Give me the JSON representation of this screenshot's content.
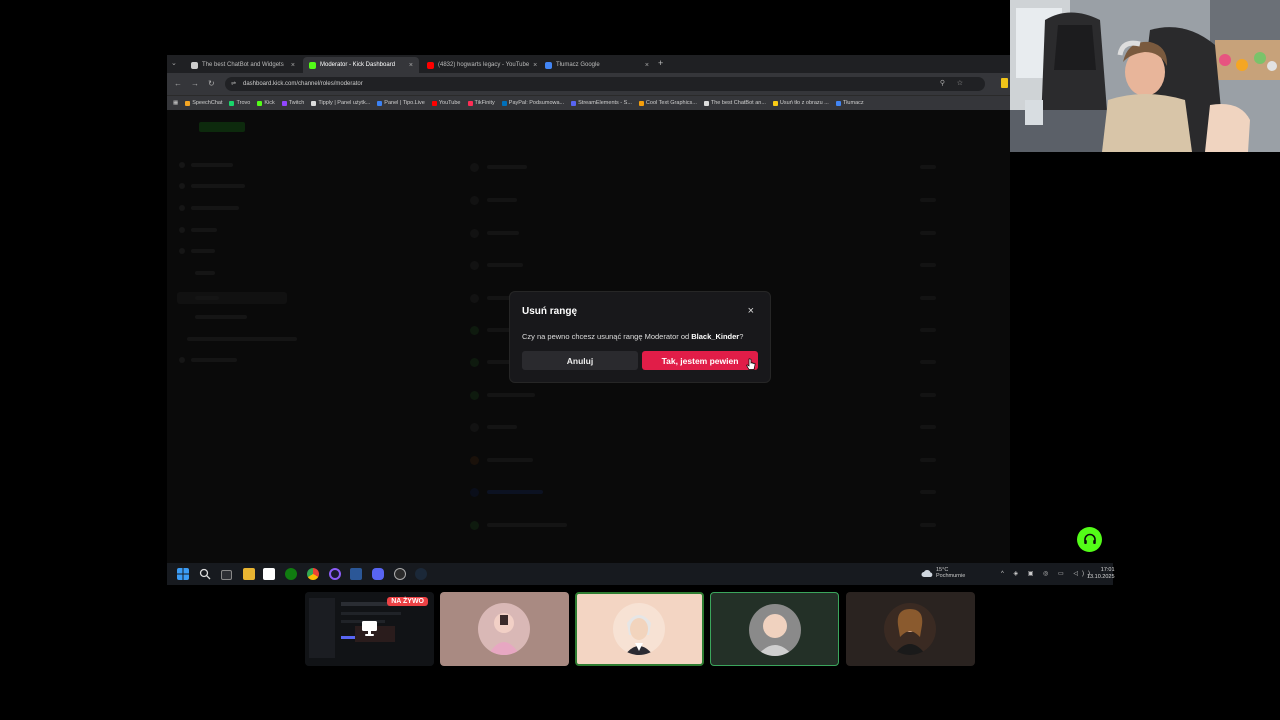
{
  "browser": {
    "tabs": [
      {
        "label": "The best ChatBot and Widgets",
        "active": false,
        "color": "#cccccc"
      },
      {
        "label": "Moderator - Kick Dashboard",
        "active": true,
        "color": "#53fc18"
      },
      {
        "label": "(4832) hogwarts legacy - YouTube",
        "active": false,
        "color": "#ff0000"
      },
      {
        "label": "Tłumacz Google",
        "active": false,
        "color": "#4285f4"
      }
    ],
    "new_tab": "+",
    "url": "dashboard.kick.com/channel/roles/moderator",
    "bookmarks": [
      {
        "label": "SpeechChat",
        "color": "#f5a623"
      },
      {
        "label": "Trovo",
        "color": "#19d66b"
      },
      {
        "label": "Kick",
        "color": "#53fc18"
      },
      {
        "label": "Twitch",
        "color": "#9146ff"
      },
      {
        "label": "Tipply | Panel użytk...",
        "color": "#dddddd"
      },
      {
        "label": "Panel | Tipo.Live",
        "color": "#3b82f6"
      },
      {
        "label": "YouTube",
        "color": "#ff0000"
      },
      {
        "label": "TikFinity",
        "color": "#ff2d55"
      },
      {
        "label": "PayPal: Podsumowa...",
        "color": "#0070ba"
      },
      {
        "label": "StreamElements - S...",
        "color": "#5865f2"
      },
      {
        "label": "Cool Text Graphics...",
        "color": "#f59e0b"
      },
      {
        "label": "The best ChatBot an...",
        "color": "#dddddd"
      },
      {
        "label": "Usuń tło z obrazu ...",
        "color": "#facc15"
      },
      {
        "label": "Tłumacz",
        "color": "#4285f4"
      }
    ]
  },
  "modal": {
    "title": "Usuń rangę",
    "close_icon": "×",
    "message_prefix": "Czy na pewno chcesz usunąć rangę Moderator od ",
    "username": "Black_Kinder",
    "message_suffix": "?",
    "cancel_label": "Anuluj",
    "confirm_label": "Tak, jestem pewien",
    "confirm_color": "#e11d48"
  },
  "taskbar": {
    "weather_temp": "15°C",
    "weather_desc": "Pochmurnie",
    "time": "17:01",
    "date": "13.10.2025"
  },
  "call": {
    "live_badge": "NA ŻYWO"
  },
  "accent": "#53fc18"
}
